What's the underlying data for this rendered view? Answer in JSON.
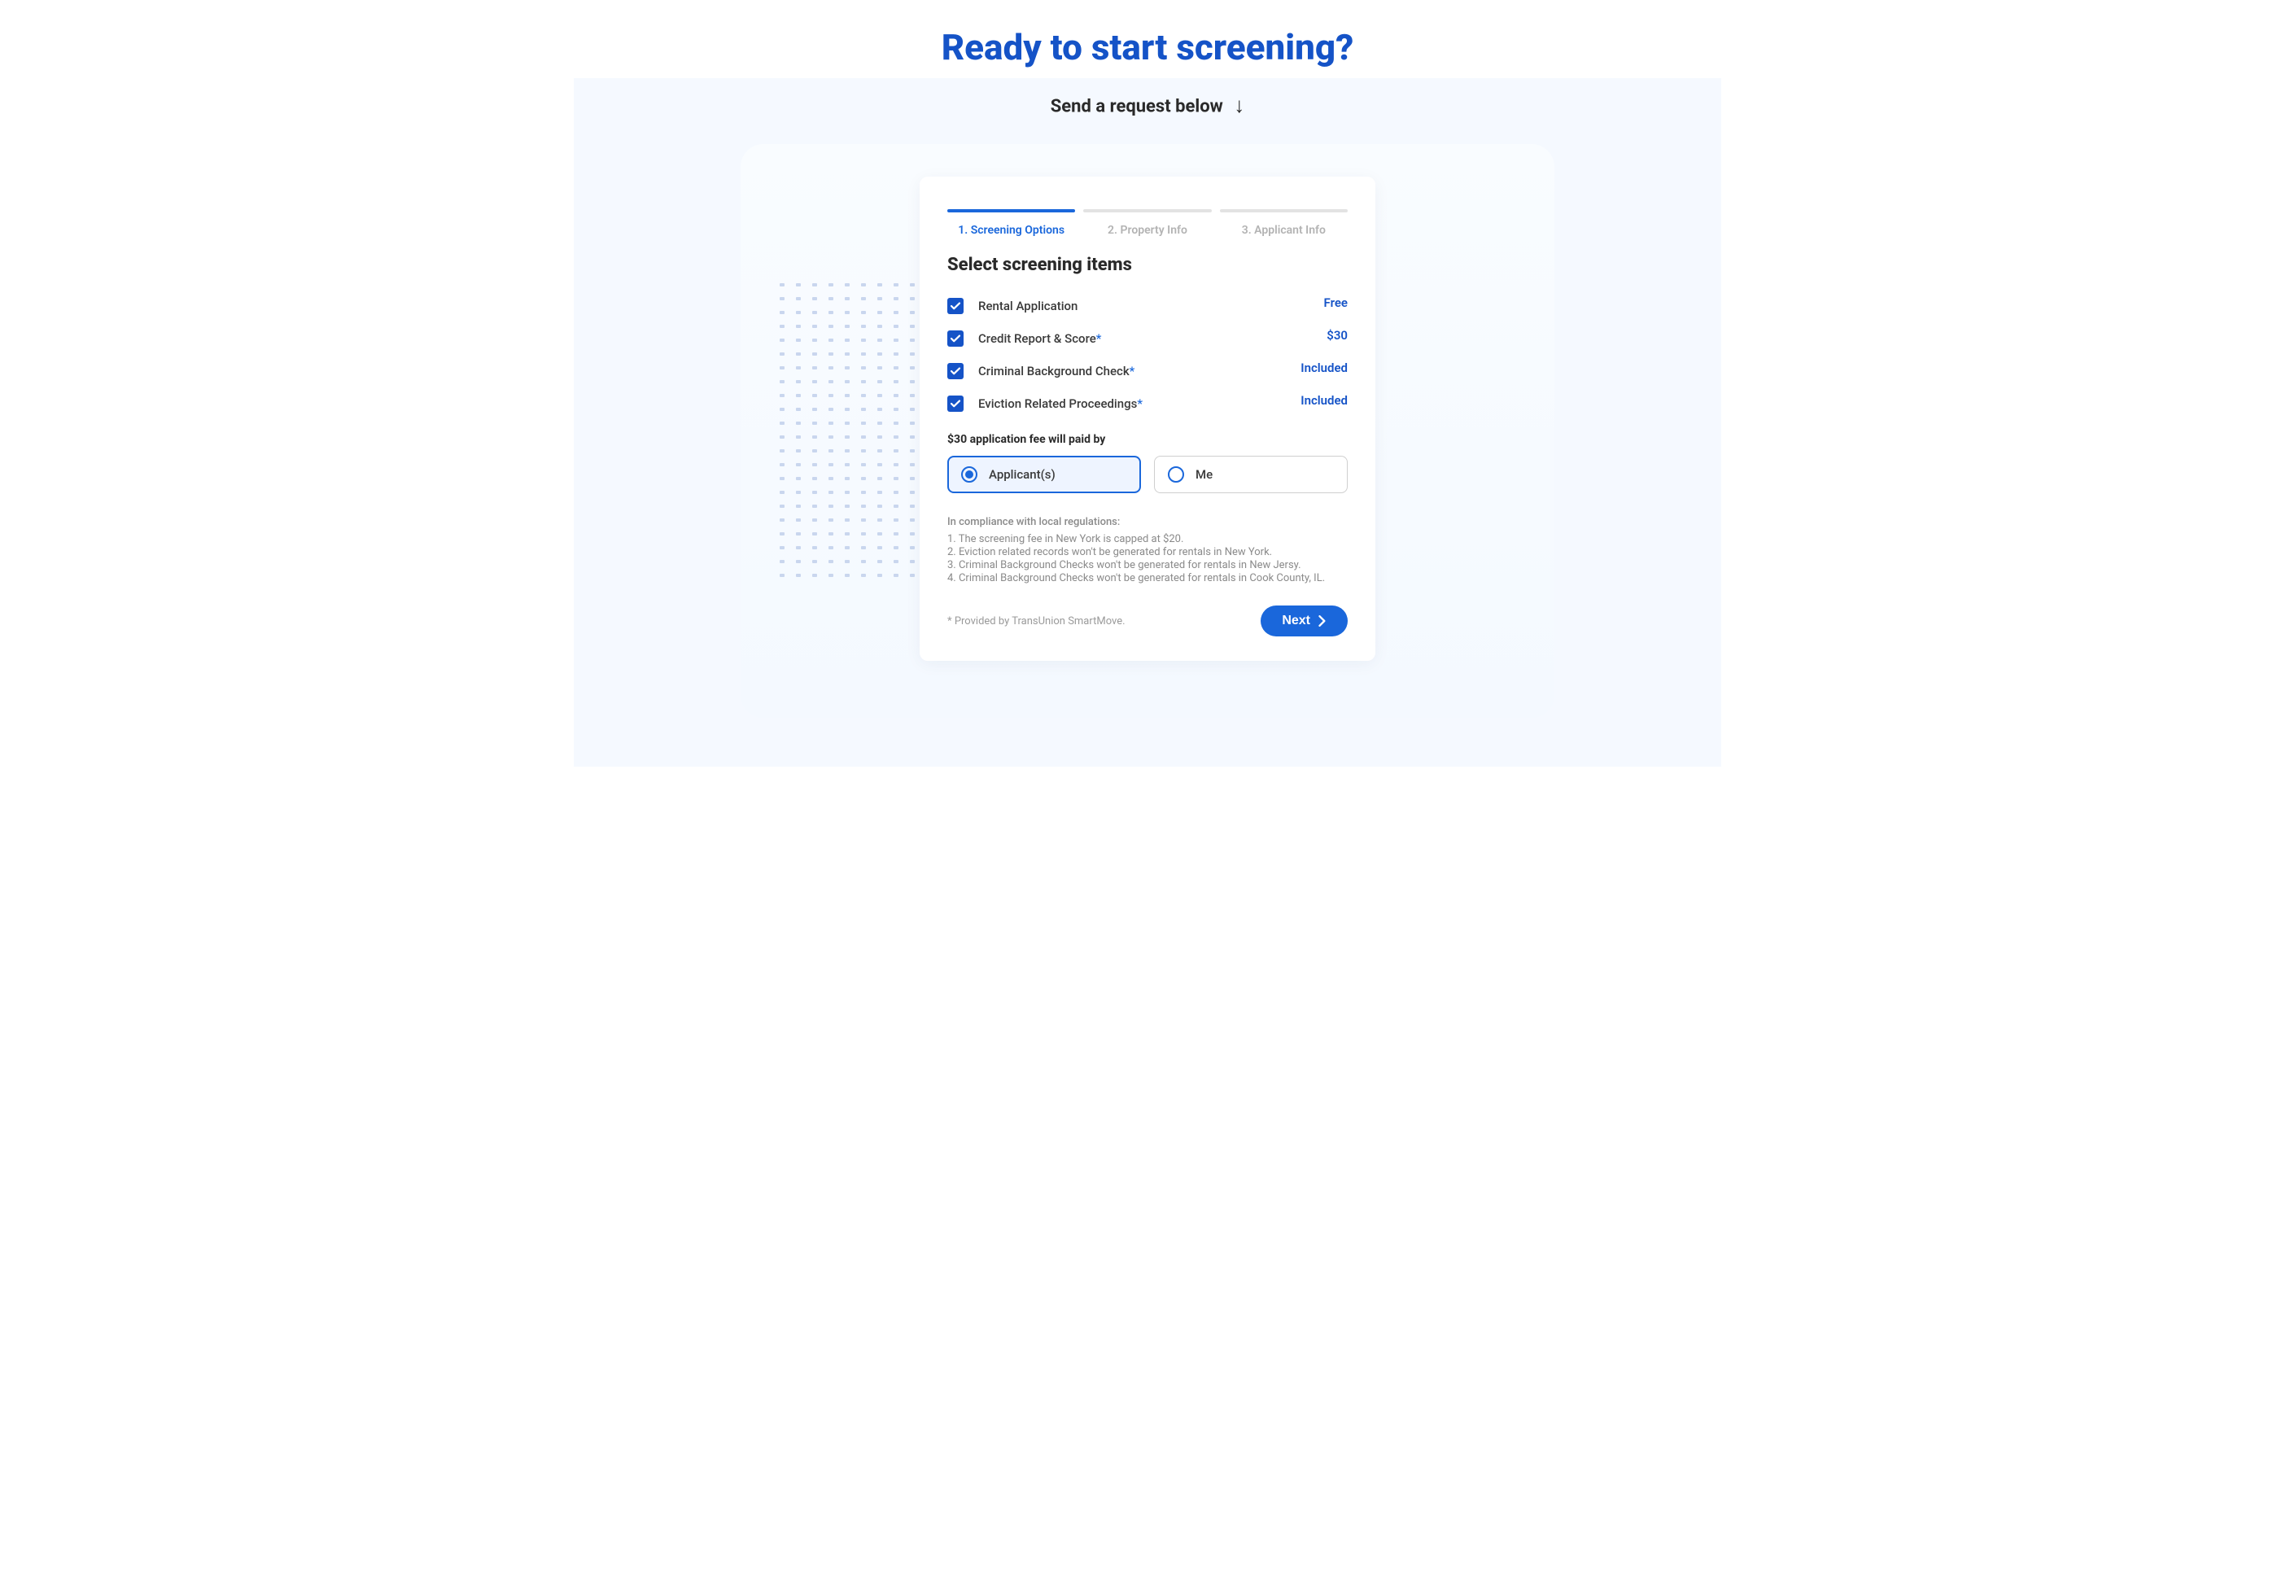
{
  "hero": {
    "title": "Ready to start screening?",
    "subtitle": "Send a request below",
    "arrow_glyph": "↓"
  },
  "steps": [
    {
      "label": "1. Screening Options",
      "active": true
    },
    {
      "label": "2. Property Info",
      "active": false
    },
    {
      "label": "3. Applicant Info",
      "active": false
    }
  ],
  "section_title": "Select screening items",
  "items": [
    {
      "label": "Rental Application",
      "asterisk": false,
      "price": "Free"
    },
    {
      "label": "Credit Report & Score",
      "asterisk": true,
      "price": "$30"
    },
    {
      "label": "Criminal Background Check",
      "asterisk": true,
      "price": "Included"
    },
    {
      "label": "Eviction Related Proceedings",
      "asterisk": true,
      "price": "Included"
    }
  ],
  "fee": {
    "label": "$30 application fee will paid by",
    "options": [
      {
        "label": "Applicant(s)",
        "selected": true
      },
      {
        "label": "Me",
        "selected": false
      }
    ]
  },
  "compliance": {
    "head": "In compliance with local regulations:",
    "lines": [
      "1. The screening fee in New York is capped at $20.",
      "2. Eviction related records won't be generated for rentals in New York.",
      "3. Criminal Background Checks won't be generated for rentals in New Jersy.",
      "4. Criminal Background Checks won't be generated for rentals in Cook County, IL."
    ]
  },
  "footnote": "* Provided by TransUnion SmartMove.",
  "next_label": "Next"
}
